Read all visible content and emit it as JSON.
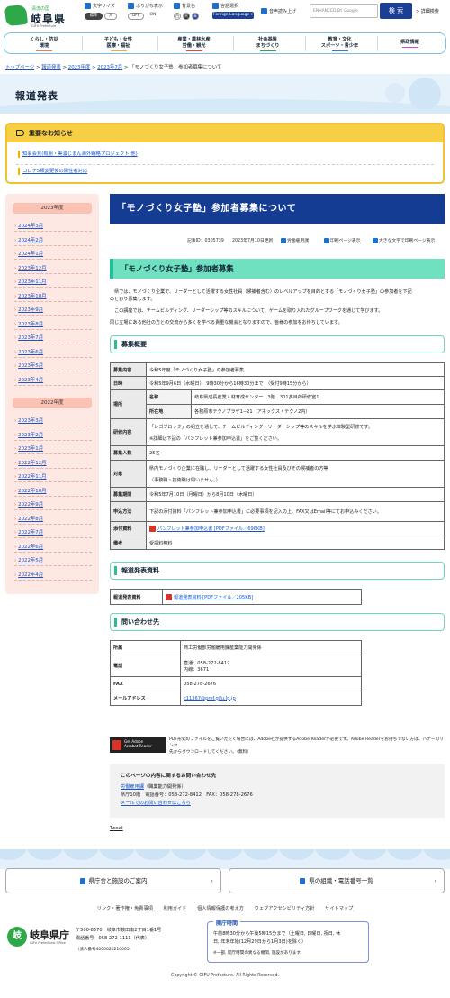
{
  "header": {
    "logo_tagline": "清流の国",
    "logo_name": "岐阜県",
    "logo_en": "GIFU Prefecture",
    "font_size_label": "文字サイズ",
    "font_size_std": "標準",
    "font_size_large": "大",
    "furigana_label": "ふりがな表示",
    "furigana_off": "OFF",
    "furigana_on": "ON",
    "bgcolor_label": "背景色",
    "bg_white": "白",
    "bg_black": "黒",
    "bg_blue": "青",
    "lang_label": "言語選択",
    "lang_button": "Foreign Language ▾",
    "voice_label": "音声読み上げ",
    "search_placeholder": "ENHANCED BY Google",
    "search_button": "検 索",
    "detail_search": "詳細検索"
  },
  "nav": [
    {
      "l1": "くらし・防災",
      "l2": "環境",
      "color": "#f07b4b"
    },
    {
      "l1": "子ども・女性",
      "l2": "医療・福祉",
      "color": "#f2a93b"
    },
    {
      "l1": "産業・農林水産",
      "l2": "労働・観光",
      "color": "#e2483a"
    },
    {
      "l1": "社会基盤",
      "l2": "まちづくり",
      "color": "#3d9e5b"
    },
    {
      "l1": "教育・文化",
      "l2": "スポーツ・青少年",
      "color": "#3b78c9"
    },
    {
      "l1": "県政情報",
      "l2": "",
      "color": "#c44ec0"
    }
  ],
  "breadcrumb": {
    "items": [
      "トップページ",
      "報道発表",
      "2023年度",
      "2023年7月"
    ],
    "current": "「モノづくり女子塾」参加者募集について",
    "sep": ">"
  },
  "hero": {
    "title": "報道発表"
  },
  "notice": {
    "title": "重要なお知らせ",
    "items": [
      "知事会見(有朋・美濃じまん海外戦略プロジェクト 他)",
      "コロナ5類変更後の陽性者対応"
    ]
  },
  "sidebar": {
    "groups": [
      {
        "year": "2023年度",
        "months": [
          "2024年3月",
          "2024年2月",
          "2024年1月",
          "2023年12月",
          "2023年11月",
          "2023年10月",
          "2023年9月",
          "2023年8月",
          "2023年7月",
          "2023年6月",
          "2023年5月",
          "2023年4月"
        ]
      },
      {
        "year": "2022年度",
        "months": [
          "2023年3月",
          "2023年2月",
          "2023年1月",
          "2022年12月",
          "2022年11月",
          "2022年10月",
          "2022年9月",
          "2022年8月",
          "2022年7月",
          "2022年6月",
          "2022年5月",
          "2022年4月"
        ]
      }
    ]
  },
  "article": {
    "title": "「モノづくり女子塾」参加者募集について",
    "meta_id": "記事ID：0305739",
    "meta_date": "2023年7月10日更新",
    "meta_dept": "労働雇用課",
    "meta_print": "印刷ページ表示",
    "meta_bigprint": "大きな文字で印刷ページ表示",
    "heading": "「モノづくり女子塾」参加者募集",
    "para1a": "　県では、モノづくり企業で、リーダーとして活躍する女性社員（候補者含む）のレベルアップを目的とする「モノづくり女子塾」の参加者を下記",
    "para1b": "のとおり募集します。",
    "para2": "　この講座では、チームビルディング、リーダーシップ等のスキルについて、ゲームを取り入れたグループワークを通じて学びます。",
    "para3": "同じ立場にある他社の方との交流から多くを学べる貴重な機会となりますので、皆様の参加をお待ちしています。",
    "sec_outline": "募集概要",
    "rows": {
      "r1h": "募集内容",
      "r1v": "令和5年度「モノづくり女子塾」の参加者募集",
      "r2h": "日時",
      "r2v": "令和5年9月6日（水曜日）　9時30分から16時30分まで　（受付9時15分から）",
      "r3h": "場所",
      "r3a": "名称",
      "r3av": "岐阜県成長産業人材育成センター　3階　301多目的研修室1",
      "r3b": "所在地",
      "r3bv": "各務原市テクノプラザ1−21（アネックス・テクノ2内）",
      "r4h": "研修内容",
      "r4v1": "「レゴブロック」の組立を通して、チームビルディング・リーダーシップ等のスキルを学ぶ体験型研修です。",
      "r4v2": "※詳細は下記の「パンフレット兼参加申込書」をご覧ください。",
      "r5h": "募集人数",
      "r5v": "25名",
      "r6h": "対象",
      "r6v1": "県内モノづくり企業に在職し、リーダーとして活躍する女性社員及びその候補者の方等",
      "r6v2": "（事務職・技術職は問いません。）",
      "r7h": "募集期間",
      "r7v": "令和5年7月10日（月曜日）から8月10日（木曜日）",
      "r8h": "申込方法",
      "r8v": "下記の添付資料「パンフレット兼参加申込書」に必要事項を記入の上、FAX又はEmail等にてお申込みください。",
      "r9h": "添付資料",
      "r9v": "パンフレット兼参加申込書 [PDFファイル／696KB]",
      "r10h": "備考",
      "r10v": "受講料無料"
    },
    "sec_press": "報道発表資料",
    "press_h": "報道発表資料",
    "press_v": "報道発表資料 [PDFファイル／205KB]",
    "sec_contact": "問い合わせ先",
    "contact": {
      "c1h": "所属",
      "c1v": "商工労働部労働雇用課産業能力開発係",
      "c2h": "電話",
      "c2v1": "直通：058-272-8412",
      "c2v2": "内線：3671",
      "c3h": "FAX",
      "c3v": "058-278-2676",
      "c4h": "メールアドレス",
      "c4v": "c11367@pref.gifu.lg.jp"
    },
    "adobe_label1": "Get Adobe",
    "adobe_label2": "Acrobat Reader",
    "adobe_text1": "PDF形式のファイルをご覧いただく場合には、Adobe社が提供するAdobe Readerが必要です。Adobe Readerをお持ちでない方は、バナーのリンク",
    "adobe_text2": "先からダウンロードしてください。（無料）",
    "inq_title": "このページの内容に関するお問い合わせ先",
    "inq_dept": "労働雇用課",
    "inq_dept_sub": "（職業能力開発係）",
    "inq_tel": "県庁10階　電話番号：058-272-8412　FAX：058-278-2676",
    "inq_mail": "メールでのお問い合わせはこちら",
    "tweet": "Tweet"
  },
  "footer": {
    "btn_guide": "県庁舎と施設のご案内",
    "btn_org": "県の組織・電話番号一覧",
    "links": [
      "リンク・著作権・免責事項",
      "利用ガイド",
      "個人情報保護の考え方",
      "ウェブアクセシビリティ方針",
      "サイトマップ"
    ],
    "logo_mark": "岐",
    "logo_name": "岐阜県庁",
    "logo_en": "GIFU Prefectural Office",
    "addr1": "〒500-8570　岐阜市薮田南2丁目1番1号",
    "addr2": "電話番号　058-272-1111（代表）",
    "addr3": "（法人番号4000020210005）",
    "hours_title": "開庁時間",
    "hours1": "午前8時30分から午後5時15分まで（土曜日, 日曜日, 祝日, 休",
    "hours2": "日, 年末年始(12月29日から1月3日)を除く）",
    "hours3": "※一部, 開庁時間の異なる機関, 施設があります。",
    "copyright": "Copyright © GIFU Prefecture. All Rights Reserved."
  },
  "colors": {
    "accent": "#153c93",
    "heading_green": "#6fe0c0",
    "notice_yellow": "#f7cf45",
    "sidebar_pink": "#fde8e3"
  }
}
